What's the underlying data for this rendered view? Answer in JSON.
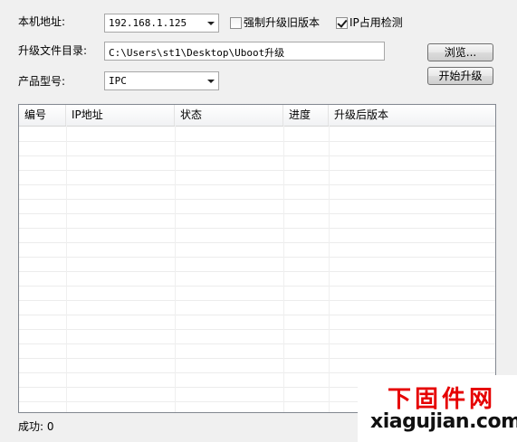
{
  "form": {
    "local_addr_label": "本机地址:",
    "local_addr_value": "192.168.1.125",
    "force_old_label": "强制升级旧版本",
    "force_old_checked": false,
    "ip_check_label": "IP占用检测",
    "ip_check_checked": true,
    "dir_label": "升级文件目录:",
    "dir_value": "C:\\Users\\st1\\Desktop\\Uboot升级",
    "browse_label": "浏览...",
    "model_label": "产品型号:",
    "model_value": "IPC",
    "start_label": "开始升级"
  },
  "table": {
    "columns": [
      "编号",
      "IP地址",
      "状态",
      "进度",
      "升级后版本"
    ],
    "rows": []
  },
  "status": {
    "success_text": "成功: 0"
  },
  "watermark": {
    "title": "下固件网",
    "url": "xiagujian.com"
  },
  "icons": {
    "combo_arrow": "chevron-down-icon",
    "checkbox_mark": "checkmark-icon"
  }
}
